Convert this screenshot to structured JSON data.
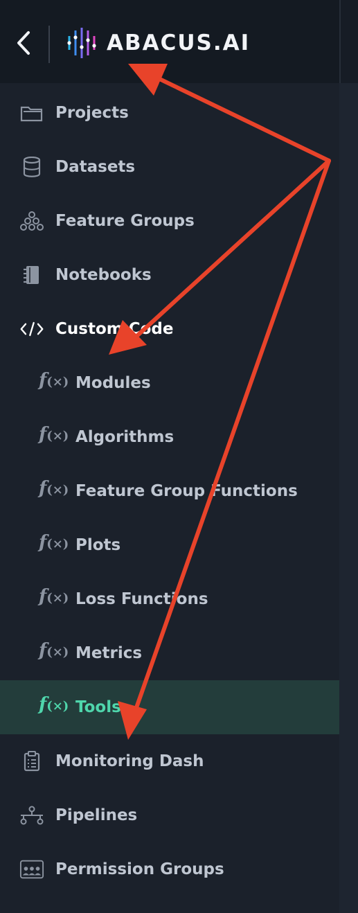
{
  "header": {
    "logo_text": "ABACUS.AI",
    "back_icon": "chevron-left-icon"
  },
  "sidebar": {
    "items": [
      {
        "label": "Projects",
        "icon": "folder-icon"
      },
      {
        "label": "Datasets",
        "icon": "database-icon"
      },
      {
        "label": "Feature Groups",
        "icon": "cluster-icon"
      },
      {
        "label": "Notebooks",
        "icon": "notebook-icon"
      },
      {
        "label": "Custom Code",
        "icon": "code-icon"
      },
      {
        "label": "Modules",
        "icon": "function-icon"
      },
      {
        "label": "Algorithms",
        "icon": "function-icon"
      },
      {
        "label": "Feature Group Functions",
        "icon": "function-icon"
      },
      {
        "label": "Plots",
        "icon": "function-icon"
      },
      {
        "label": "Loss Functions",
        "icon": "function-icon"
      },
      {
        "label": "Metrics",
        "icon": "function-icon"
      },
      {
        "label": "Tools",
        "icon": "function-icon"
      },
      {
        "label": "Monitoring Dash",
        "icon": "clipboard-icon"
      },
      {
        "label": "Pipelines",
        "icon": "pipeline-icon"
      },
      {
        "label": "Permission Groups",
        "icon": "people-icon"
      }
    ],
    "fx_main": "f",
    "fx_arg": "(×)"
  },
  "colors": {
    "sidebar_bg": "#1b212b",
    "header_bg": "#141a22",
    "selected_bg": "#233d3b",
    "selected_text": "#4fd6ac",
    "arrow": "#e8432a"
  },
  "annotations": {
    "arrows": 3,
    "targets": [
      "logo",
      "Custom Code",
      "Tools"
    ]
  }
}
